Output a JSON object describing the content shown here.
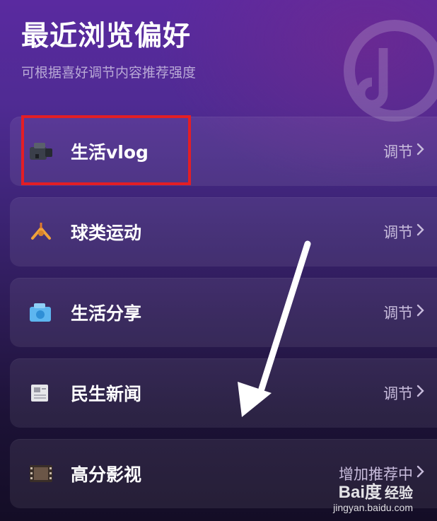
{
  "header": {
    "title": "最近浏览偏好",
    "subtitle": "可根据喜好调节内容推荐强度"
  },
  "items": [
    {
      "icon": "camera-icon",
      "label": "生活vlog",
      "action": "调节",
      "highlighted": true
    },
    {
      "icon": "badminton-icon",
      "label": "球类运动",
      "action": "调节"
    },
    {
      "icon": "photo-share-icon",
      "label": "生活分享",
      "action": "调节"
    },
    {
      "icon": "newspaper-icon",
      "label": "民生新闻",
      "action": "调节"
    },
    {
      "icon": "film-icon",
      "label": "高分影视",
      "action": "增加推荐中"
    }
  ],
  "watermark": {
    "brand": "Bai度",
    "suffix": "经验",
    "url": "jingyan.baidu.com"
  },
  "colors": {
    "highlight_box": "#e41e25",
    "annotation_arrow": "#ffffff"
  }
}
